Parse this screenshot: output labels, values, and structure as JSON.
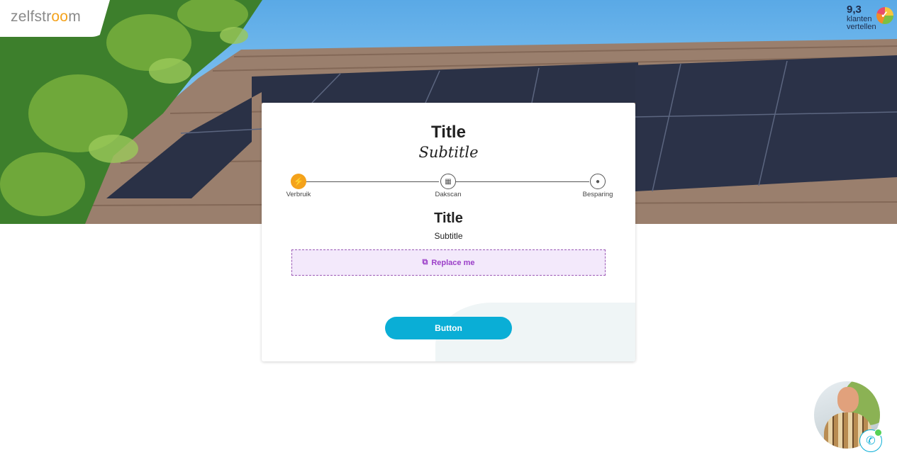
{
  "brand": {
    "logo_pre": "zelfstr",
    "logo_oo": "oo",
    "logo_post": "m"
  },
  "rating": {
    "score": "9,3",
    "line1": "klanten",
    "line2": "vertellen"
  },
  "card": {
    "title": "Title",
    "subtitle": "Subtitle",
    "steps": [
      {
        "label": "Verbruik",
        "icon": "lightning-icon",
        "active": true
      },
      {
        "label": "Dakscan",
        "icon": "solar-panel-icon",
        "active": false
      },
      {
        "label": "Besparing",
        "icon": "piggy-bank-icon",
        "active": false
      }
    ],
    "section_title": "Title",
    "section_subtitle": "Subtitle",
    "placeholder_label": "Replace me",
    "button_label": "Button"
  },
  "colors": {
    "accent": "#0aaed6",
    "step_active": "#f4a21b",
    "placeholder": "#9b3fc8"
  }
}
